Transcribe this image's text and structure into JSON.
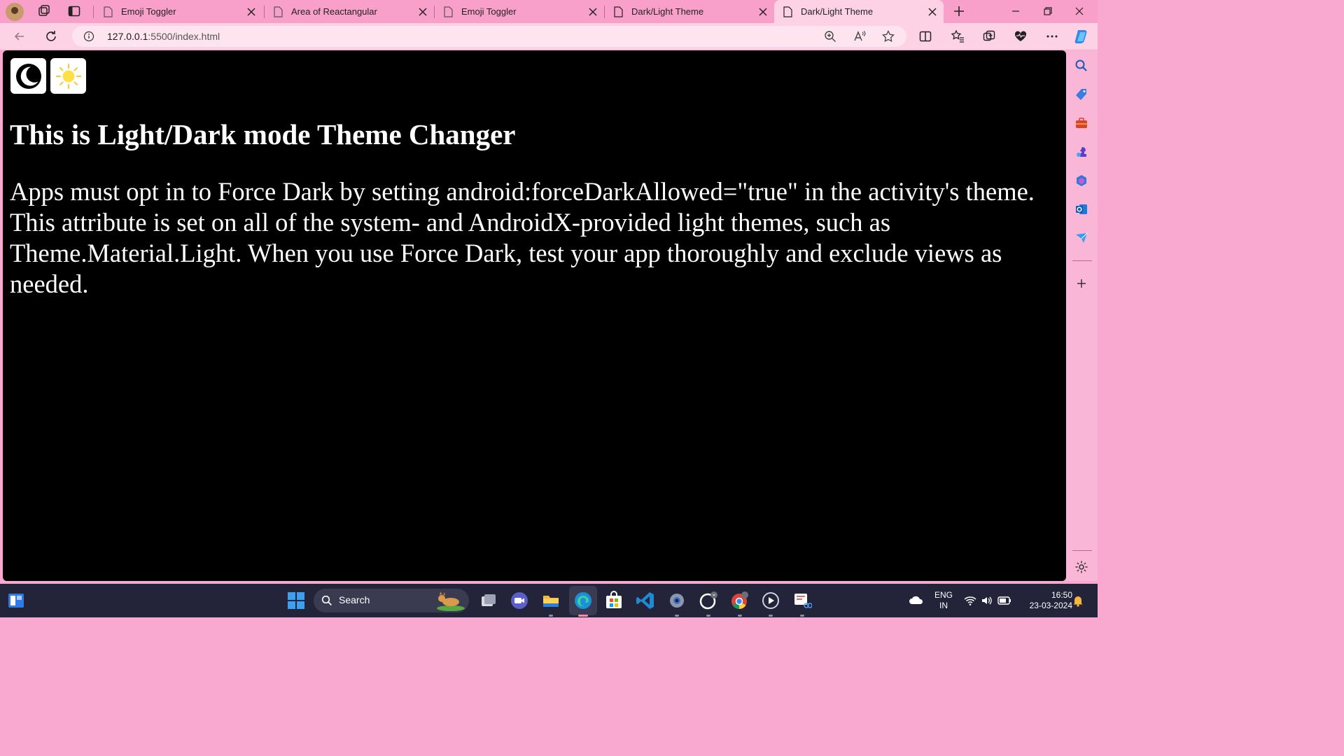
{
  "browser": {
    "tabs": [
      {
        "title": "Emoji Toggler",
        "active": false
      },
      {
        "title": "Area of Reactangular",
        "active": false
      },
      {
        "title": "Emoji Toggler",
        "active": false
      },
      {
        "title": "Dark/Light Theme",
        "active": false
      },
      {
        "title": "Dark/Light Theme",
        "active": true
      }
    ],
    "address": {
      "host": "127.0.0.1",
      "rest": ":5500/index.html"
    }
  },
  "page": {
    "heading": "This is Light/Dark mode Theme Changer",
    "paragraph": "Apps must opt in to Force Dark by setting android:forceDarkAllowed=\"true\" in the activity's theme. This attribute is set on all of the system- and AndroidX-provided light themes, such as Theme.Material.Light. When you use Force Dark, test your app thoroughly and exclude views as needed.",
    "buttons": [
      {
        "icon": "moon-icon"
      },
      {
        "icon": "sun-icon"
      }
    ],
    "background": "#000000",
    "text_color": "#ffffff"
  },
  "taskbar": {
    "search_label": "Search",
    "language": "ENG",
    "region": "IN",
    "time": "16:50",
    "date": "23-03-2024"
  },
  "colors": {
    "tab_strip": "#f8a0c9",
    "active_tab": "#fdd2e4",
    "taskbar": "#23243a"
  }
}
